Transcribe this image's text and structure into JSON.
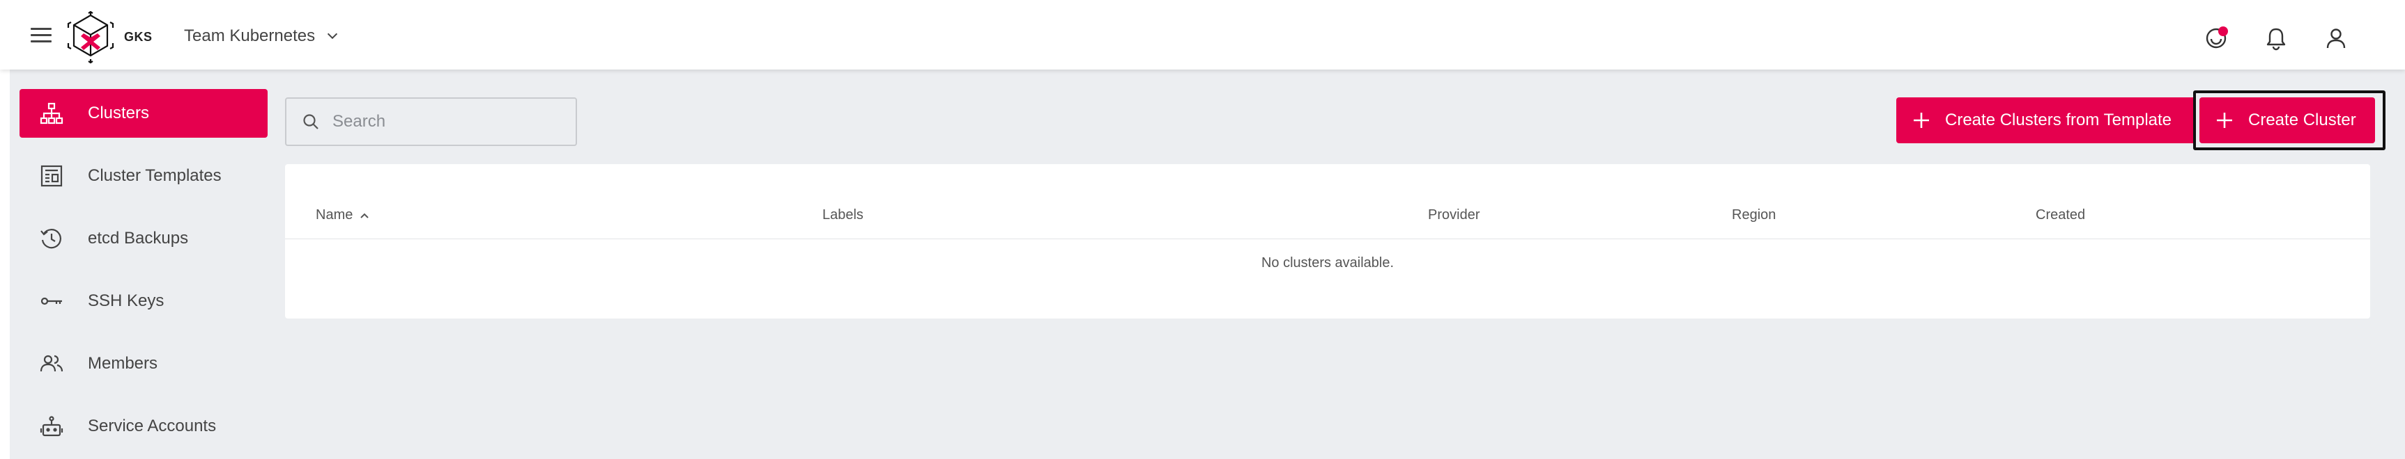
{
  "header": {
    "brand": "GKS",
    "project": "Team Kubernetes",
    "icons": [
      "theme-icon",
      "bell-icon",
      "account-icon"
    ]
  },
  "sidebar": {
    "items": [
      {
        "label": "Clusters",
        "icon": "cluster-tree-icon",
        "active": true
      },
      {
        "label": "Cluster Templates",
        "icon": "template-icon",
        "active": false
      },
      {
        "label": "etcd Backups",
        "icon": "history-icon",
        "active": false
      },
      {
        "label": "SSH Keys",
        "icon": "key-icon",
        "active": false
      },
      {
        "label": "Members",
        "icon": "members-icon",
        "active": false
      },
      {
        "label": "Service Accounts",
        "icon": "robot-icon",
        "active": false
      }
    ]
  },
  "search": {
    "placeholder": "Search",
    "value": ""
  },
  "actions": {
    "create_from_template": "Create Clusters from Template",
    "create_cluster": "Create Cluster"
  },
  "table": {
    "columns": [
      "Name",
      "Labels",
      "Provider",
      "Region",
      "Created"
    ],
    "sort_column": "Name",
    "sort_direction": "ascending",
    "rows": [],
    "empty_message": "No clusters available."
  },
  "colors": {
    "accent": "#e5004e",
    "background": "#eceef1",
    "surface": "#ffffff"
  }
}
